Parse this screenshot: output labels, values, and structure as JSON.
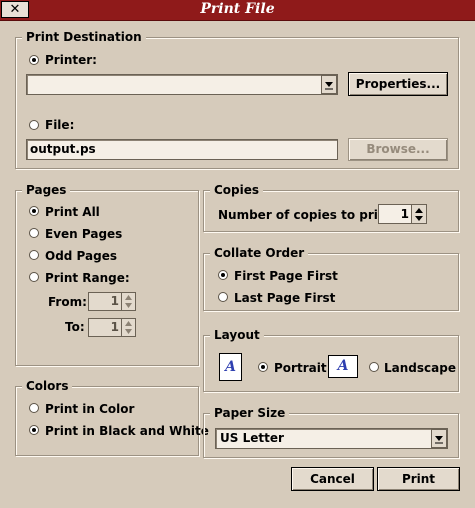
{
  "window": {
    "title": "Print File",
    "close_glyph": "✕"
  },
  "destination": {
    "legend": "Print Destination",
    "printer_label": "Printer:",
    "printer_selected": true,
    "printer_value": "",
    "properties_button": "Properties...",
    "file_label": "File:",
    "file_selected": false,
    "file_value": "output.ps",
    "browse_button": "Browse...",
    "browse_enabled": false
  },
  "pages": {
    "legend": "Pages",
    "options": [
      "Print All",
      "Even Pages",
      "Odd Pages",
      "Print Range:"
    ],
    "selected_index": 0,
    "from_label": "From:",
    "from_value": "1",
    "to_label": "To:",
    "to_value": "1"
  },
  "copies": {
    "legend": "Copies",
    "label": "Number of copies to print:",
    "value": "1"
  },
  "collate": {
    "legend": "Collate Order",
    "options": [
      "First Page First",
      "Last Page First"
    ],
    "selected_index": 0
  },
  "layout": {
    "legend": "Layout",
    "portrait_label": "Portrait",
    "landscape_label": "Landscape",
    "icon_glyph": "A",
    "selected": "portrait"
  },
  "colors": {
    "legend": "Colors",
    "options": [
      "Print in Color",
      "Print in Black and White"
    ],
    "selected_index": 1
  },
  "paper": {
    "legend": "Paper Size",
    "value": "US Letter"
  },
  "actions": {
    "cancel": "Cancel",
    "print": "Print"
  },
  "theme": {
    "titlebar": "#8f1a1a",
    "background": "#d6cbbb",
    "field": "#f5efe6"
  }
}
